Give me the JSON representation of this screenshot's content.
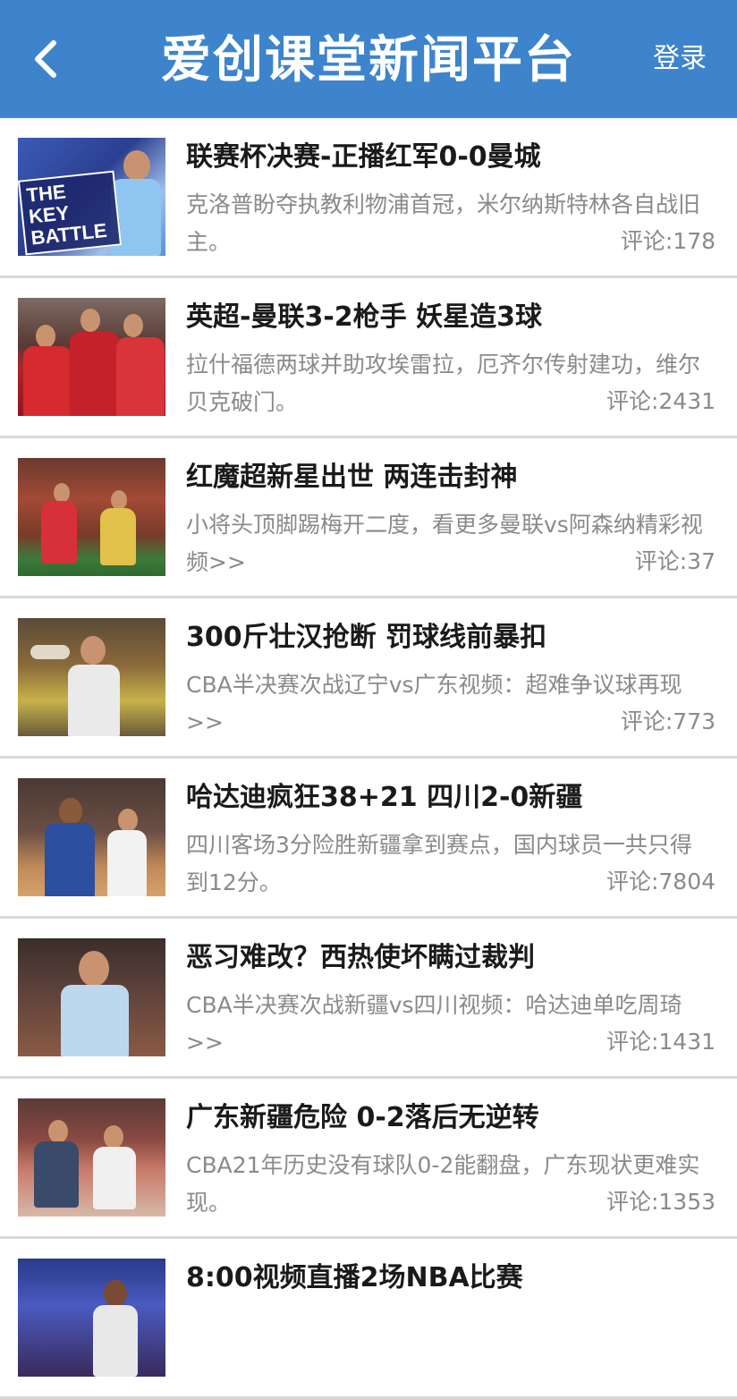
{
  "header": {
    "title": "爱创课堂新闻平台",
    "login_label": "登录",
    "background": "#3d84cc",
    "back_icon": "chevron-left-icon"
  },
  "news": [
    {
      "title": "联赛杯决赛-正播红军0-0曼城",
      "summary": "克洛普盼夺执教利物浦首冠，米尔纳斯特林各自战旧主。",
      "comments": "评论:178",
      "thumb_text": "THE KEY BATTLE"
    },
    {
      "title": "英超-曼联3-2枪手 妖星造3球",
      "summary": "拉什福德两球并助攻埃雷拉，厄齐尔传射建功，维尔贝克破门。",
      "comments": "评论:2431"
    },
    {
      "title": "红魔超新星出世 两连击封神",
      "summary": "小将头顶脚踢梅开二度，看更多曼联vs阿森纳精彩视频>>",
      "comments": "评论:37"
    },
    {
      "title": "300斤壮汉抢断 罚球线前暴扣",
      "summary": "CBA半决赛次战辽宁vs广东视频：超难争议球再现>>",
      "comments": "评论:773"
    },
    {
      "title": "哈达迪疯狂38+21 四川2-0新疆",
      "summary": "四川客场3分险胜新疆拿到赛点，国内球员一共只得到12分。",
      "comments": "评论:7804"
    },
    {
      "title": "恶习难改？西热使坏瞒过裁判",
      "summary": "CBA半决赛次战新疆vs四川视频：哈达迪单吃周琦>>",
      "comments": "评论:1431"
    },
    {
      "title": "广东新疆危险 0-2落后无逆转",
      "summary": "CBA21年历史没有球队0-2能翻盘，广东现状更难实现。",
      "comments": "评论:1353"
    },
    {
      "title": "8:00视频直播2场NBA比赛",
      "summary": "",
      "comments": ""
    }
  ]
}
